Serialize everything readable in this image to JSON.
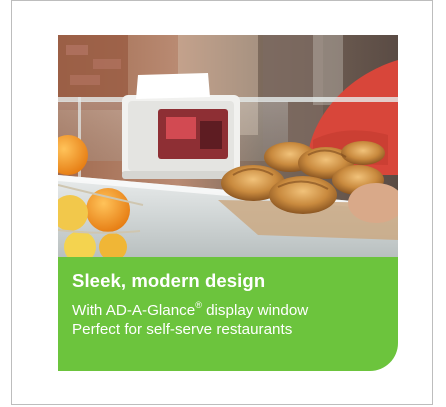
{
  "promo": {
    "image_alt": "Napkin dispenser with display window on a bakery counter beside croissants",
    "headline": "Sleek, modern design",
    "line1_prefix": "With AD-A-Glance",
    "line1_sup": "®",
    "line1_suffix": " display window",
    "line2": "Perfect for self-serve restaurants"
  },
  "colors": {
    "panel_green": "#6cc43d",
    "text_white": "#ffffff",
    "frame_border": "#bdbdbd"
  }
}
